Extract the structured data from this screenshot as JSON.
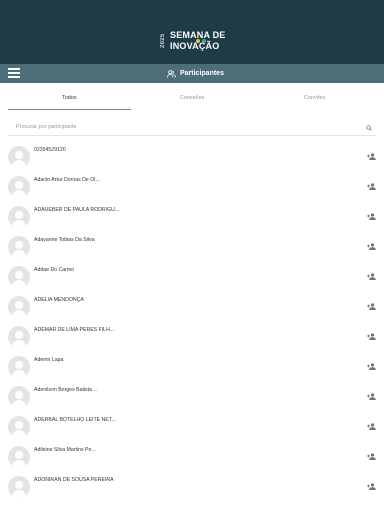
{
  "header": {
    "logo_year": "2025",
    "logo_line1": "SEMANA DE",
    "logo_line2": "INOVAÇÃO",
    "background_color": "#1e3c47"
  },
  "navbar": {
    "title": "Participantes",
    "menu_icon": "menu-icon",
    "title_icon": "people-icon"
  },
  "tabs": [
    {
      "label": "Todos",
      "active": true
    },
    {
      "label": "Conexões",
      "active": false
    },
    {
      "label": "Convites",
      "active": false
    }
  ],
  "search": {
    "placeholder": "Procurar por participante",
    "icon": "search-icon"
  },
  "participants": [
    {
      "name": "02354529120"
    },
    {
      "name": "Adacto Artur Dornas De Ol..."
    },
    {
      "name": "ADAUEBER DE PAULA RODRIGU..."
    },
    {
      "name": "Adayanne Tobias Da Silva"
    },
    {
      "name": "Addae Do Carmo"
    },
    {
      "name": "ADELIA MENDONÇA"
    },
    {
      "name": "ADEMAR DE LIMA PERES FILH..."
    },
    {
      "name": "Ademir Lapa"
    },
    {
      "name": "Adenilson Borges Batista ..."
    },
    {
      "name": "ADERBAL BOTELHO LEITE NET..."
    },
    {
      "name": "Adileine Silva Martins Pe..."
    },
    {
      "name": "ADONIRAN DE SOUSA PEREIRA"
    }
  ]
}
